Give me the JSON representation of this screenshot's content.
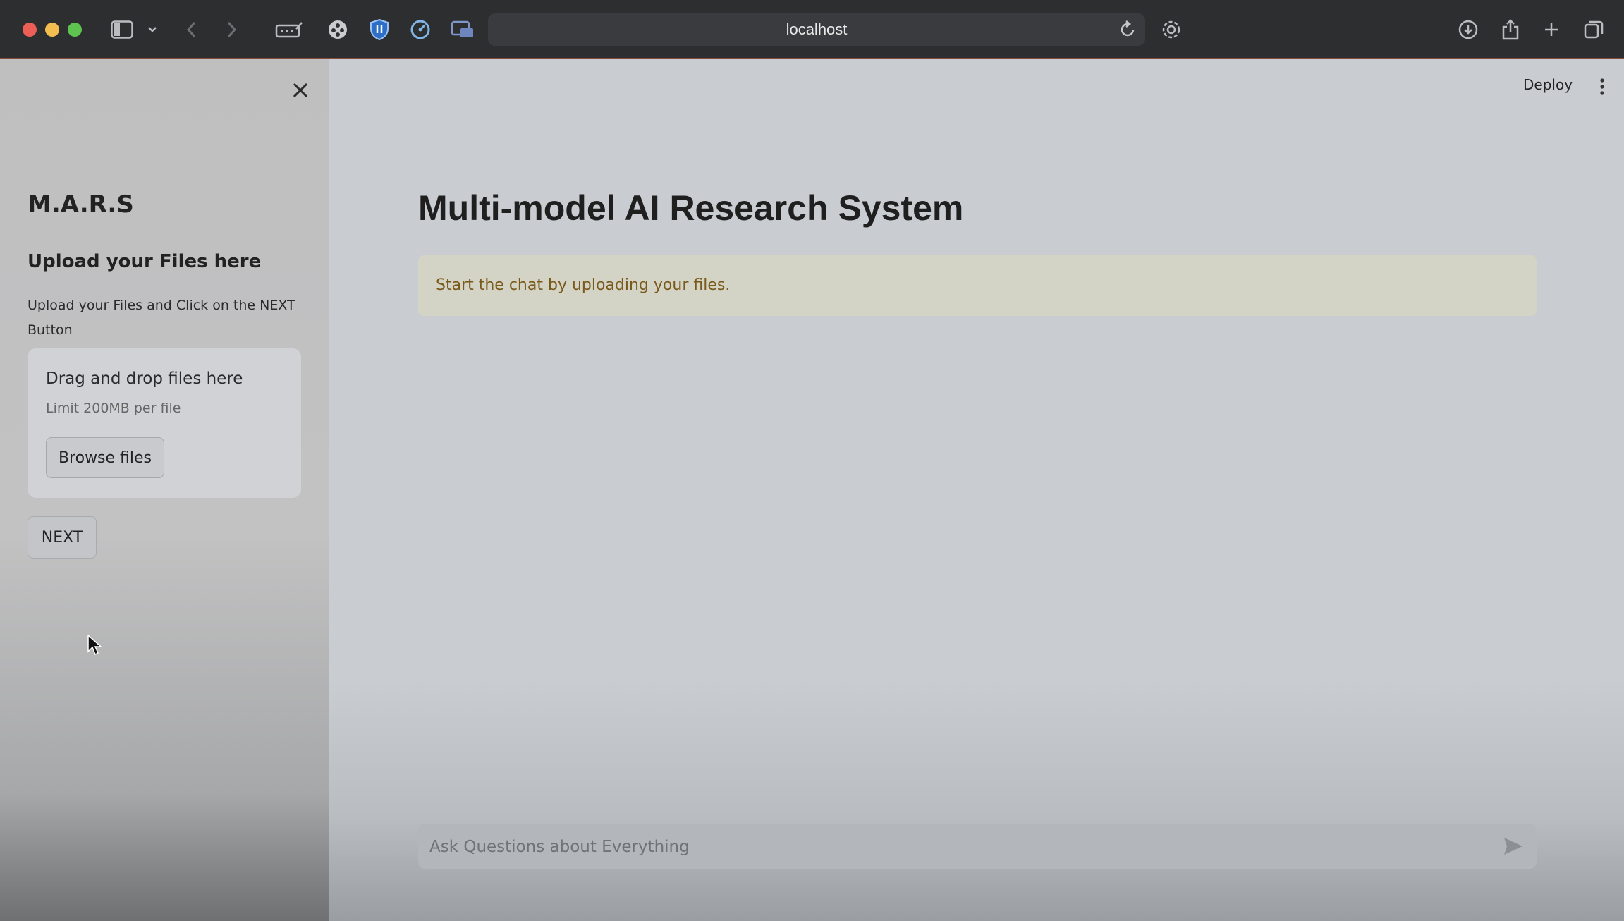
{
  "browser": {
    "url": "localhost"
  },
  "sidebar": {
    "brand": "M.A.R.S",
    "upload_heading": "Upload your Files here",
    "upload_description": "Upload your Files and Click on the NEXT Button",
    "dropzone": {
      "title": "Drag and drop files here",
      "limit": "Limit 200MB per file",
      "browse_label": "Browse files"
    },
    "next_label": "NEXT"
  },
  "header": {
    "deploy_label": "Deploy"
  },
  "main": {
    "title": "Multi-model AI Research System",
    "alert": "Start the chat by uploading your files.",
    "chat_placeholder": "Ask Questions about Everything"
  },
  "icons": [
    "sidebar-icon",
    "chevron-down-icon",
    "back-icon",
    "forward-icon",
    "password-icon",
    "extension-icon",
    "shield-icon",
    "speedometer-icon",
    "picture-in-picture-icon",
    "reload-icon",
    "settings-icon",
    "download-icon",
    "share-icon",
    "new-tab-icon",
    "tabs-overview-icon",
    "close-icon",
    "kebab-menu-icon",
    "send-icon"
  ],
  "colors": {
    "alert_bg": "#d3d3c6",
    "alert_text": "#7a5a1a"
  }
}
